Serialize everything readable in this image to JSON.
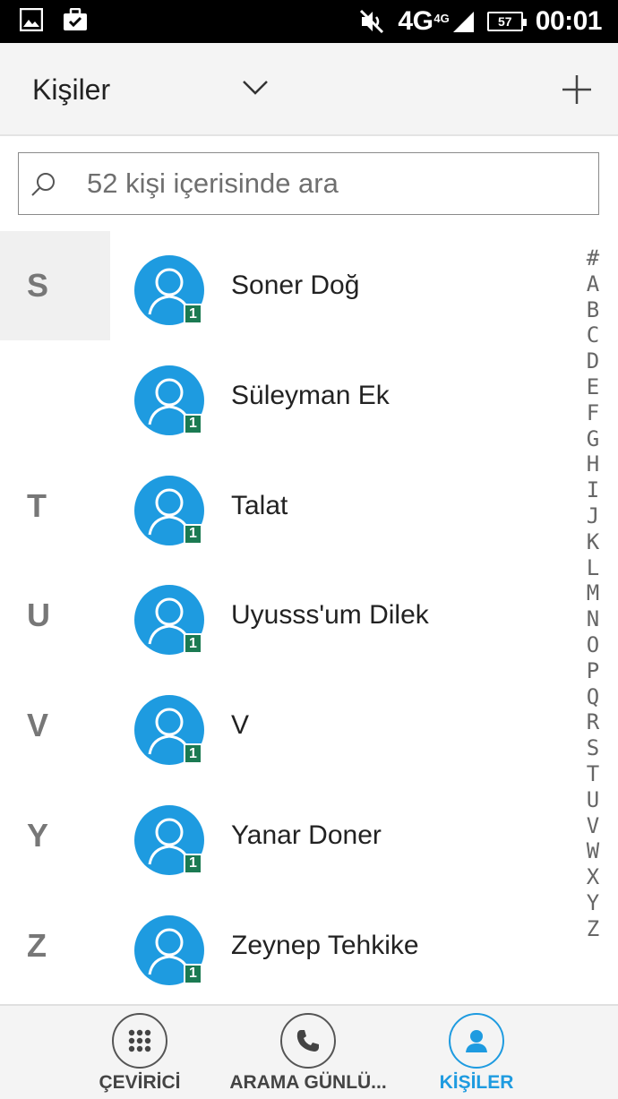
{
  "statusbar": {
    "network": "4G",
    "network_small": "4G",
    "battery": "57",
    "time": "00:01"
  },
  "toolbar": {
    "title": "Kişiler"
  },
  "search": {
    "placeholder": "52 kişi içerisinde ara"
  },
  "contacts": [
    {
      "letter": "S",
      "name": "Soner Doğ",
      "sim": "1"
    },
    {
      "letter": "",
      "name": "Süleyman Ek",
      "sim": "1"
    },
    {
      "letter": "T",
      "name": "Talat",
      "sim": "1"
    },
    {
      "letter": "U",
      "name": "Uyusss'um Dilek",
      "sim": "1"
    },
    {
      "letter": "V",
      "name": "V",
      "sim": "1"
    },
    {
      "letter": "Y",
      "name": "Yanar Doner",
      "sim": "1"
    },
    {
      "letter": "Z",
      "name": "Zeynep Tehkike",
      "sim": "1"
    }
  ],
  "index_letters": [
    "#",
    "A",
    "B",
    "C",
    "D",
    "E",
    "F",
    "G",
    "H",
    "I",
    "J",
    "K",
    "L",
    "M",
    "N",
    "O",
    "P",
    "Q",
    "R",
    "S",
    "T",
    "U",
    "V",
    "W",
    "X",
    "Y",
    "Z"
  ],
  "bottomnav": {
    "dialer": "ÇEVİRİCİ",
    "calllog": "ARAMA GÜNLÜ...",
    "contacts": "KİŞİLER"
  },
  "colors": {
    "accent": "#1e9be0",
    "avatar": "#1e9be0",
    "sim_badge": "#1b7a52"
  }
}
